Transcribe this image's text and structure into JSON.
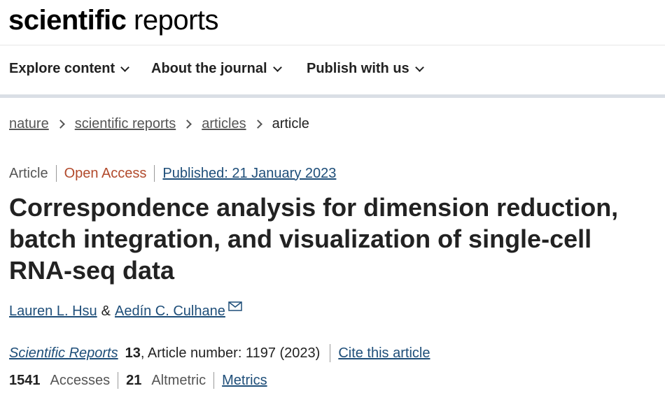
{
  "header": {
    "logo_bold": "scientific",
    "logo_light": "reports"
  },
  "nav": {
    "items": [
      {
        "label": "Explore content"
      },
      {
        "label": "About the journal"
      },
      {
        "label": "Publish with us"
      }
    ]
  },
  "breadcrumb": {
    "items": [
      "nature",
      "scientific reports",
      "articles"
    ],
    "current": "article"
  },
  "article": {
    "type": "Article",
    "access": "Open Access",
    "published": "Published: 21 January 2023",
    "title": "Correspondence analysis for dimension reduction, batch integration, and visualization of single-cell RNA-seq data",
    "authors": [
      "Lauren L. Hsu",
      "Aedín C. Culhane"
    ],
    "author_sep": "&",
    "journal": "Scientific Reports",
    "volume": "13",
    "article_number": ", Article number: 1197 (2023)",
    "cite_label": "Cite this article"
  },
  "metrics": {
    "accesses": "1541",
    "accesses_label": "Accesses",
    "altmetric": "21",
    "altmetric_label": "Altmetric",
    "metrics_link": "Metrics"
  },
  "colors": {
    "link": "#1e4e79",
    "open_access": "#b24a2c",
    "nav_border": "#dadfe5"
  }
}
